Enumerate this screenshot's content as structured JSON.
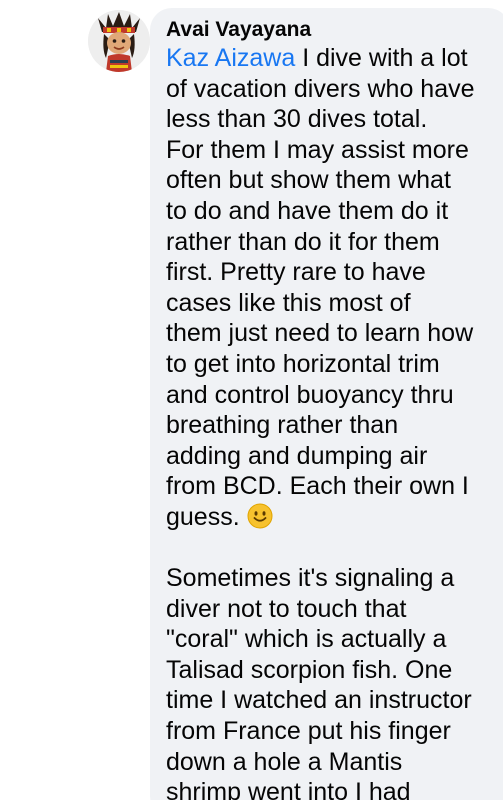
{
  "comment": {
    "author": "Avai Vayayana",
    "mention": "Kaz Aizawa",
    "paragraph1": {
      "first_line_rest": " I dive with a lot",
      "lines": [
        "of vacation divers who have",
        "less than 30 dives total.",
        "For them I may assist more",
        "often but show them what",
        "to do and have them do it",
        "rather than do it for them",
        "first.  Pretty rare to have",
        "cases like this most of",
        "them just need to learn how",
        "to get into horizontal trim",
        "and control buoyancy thru",
        "breathing rather than",
        "adding and dumping air",
        "from BCD.  Each their own I"
      ],
      "last_line": "guess. "
    },
    "paragraph2": {
      "lines": [
        "Sometimes it's signaling a",
        "diver not to touch that",
        "\"coral\" which is actually a",
        "Talisad scorpion fish.   One",
        "time I watched an instructor",
        "from France put his finger",
        "down a hole a Mantis",
        "shrimp went into I had"
      ]
    }
  },
  "icons": {
    "avatar": "cartoon-avatar",
    "emoji": "smiling-face-emoji"
  },
  "colors": {
    "bubble": "#f0f2f5",
    "mention": "#1877f2",
    "text": "#050505"
  }
}
